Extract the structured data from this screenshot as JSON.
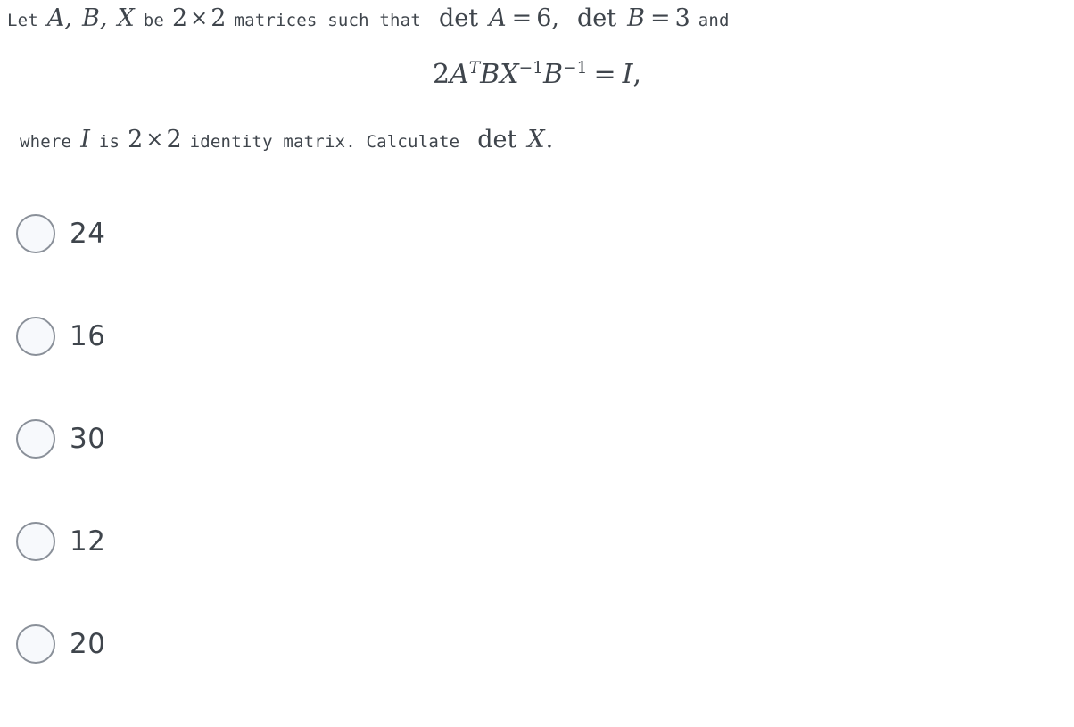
{
  "question": {
    "line1": {
      "t1": "Let",
      "v1": "A,",
      "v2": "B,",
      "v3": "X",
      "t2": "be",
      "n1": "2",
      "times1": "×",
      "n2": "2",
      "t3": "matrices such that",
      "det1": "det",
      "v4": "A",
      "eq1": "=",
      "n3": "6,",
      "det2": "det",
      "v5": "B",
      "eq2": "=",
      "n4": "3",
      "t4": "and"
    },
    "equation": {
      "coefficient": "2",
      "a": "A",
      "a_sup": "T",
      "b1": "B",
      "x": "X",
      "x_sup": "−1",
      "b2": "B",
      "b2_sup": "−1",
      "relation": "=",
      "identity": "I",
      "comma": ",",
      "plain": "2A^T B X^{-1} B^{-1} = I,"
    },
    "line3": {
      "t1": "where",
      "v1": "I",
      "t2": "is",
      "n1": "2",
      "times1": "×",
      "n2": "2",
      "t3": "identity matrix. Calculate",
      "det": "det",
      "v2": "X",
      "period": "."
    }
  },
  "options": [
    {
      "value": "24",
      "selected": false
    },
    {
      "value": "16",
      "selected": false
    },
    {
      "value": "30",
      "selected": false
    },
    {
      "value": "12",
      "selected": false
    },
    {
      "value": "20",
      "selected": false
    }
  ],
  "colors": {
    "text": "#3f454c",
    "background": "#ffffff",
    "radio_border": "#8a9099",
    "radio_fill": "#f7f9fc"
  }
}
